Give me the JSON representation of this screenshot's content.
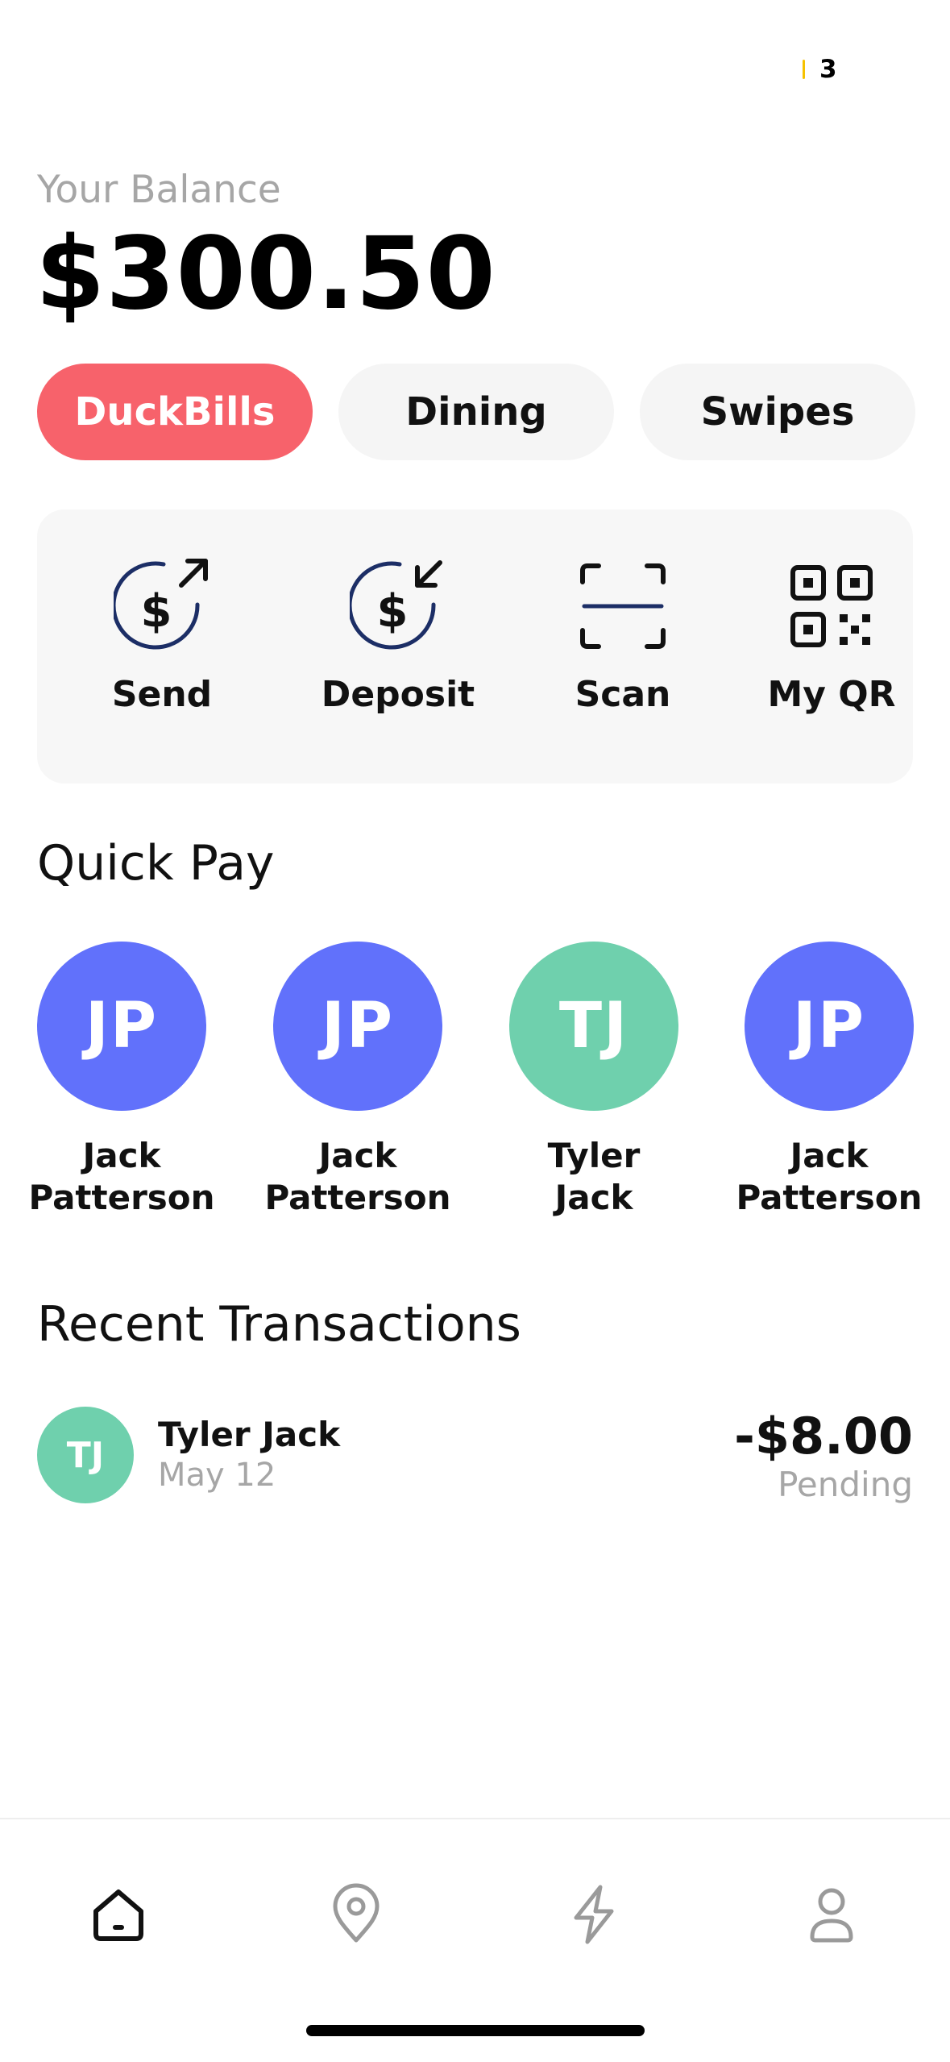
{
  "status": {
    "badge_count": "3"
  },
  "balance": {
    "label": "Your Balance",
    "value": "$300.50"
  },
  "tabs": [
    {
      "label": "DuckBills",
      "active": true
    },
    {
      "label": "Dining",
      "active": false
    },
    {
      "label": "Swipes",
      "active": false
    }
  ],
  "actions": [
    {
      "label": "Send",
      "icon": "dollar-send-icon"
    },
    {
      "label": "Deposit",
      "icon": "dollar-deposit-icon"
    },
    {
      "label": "Scan",
      "icon": "scan-icon"
    },
    {
      "label": "My QR",
      "icon": "qr-code-icon"
    }
  ],
  "quick_pay": {
    "title": "Quick Pay",
    "people": [
      {
        "initials": "JP",
        "first": "Jack",
        "last": "Patterson",
        "color": "#6171fb"
      },
      {
        "initials": "JP",
        "first": "Jack",
        "last": "Patterson",
        "color": "#6171fb"
      },
      {
        "initials": "TJ",
        "first": "Tyler",
        "last": "Jack",
        "color": "#6fd0ad"
      },
      {
        "initials": "JP",
        "first": "Jack",
        "last": "Patterson",
        "color": "#6171fb"
      }
    ]
  },
  "recent": {
    "title": "Recent Transactions",
    "items": [
      {
        "initials": "TJ",
        "name": "Tyler Jack",
        "date": "May 12",
        "amount": "-$8.00",
        "status": "Pending",
        "color": "#6fd0ad"
      }
    ]
  },
  "nav": [
    {
      "icon": "home-icon",
      "active": true
    },
    {
      "icon": "location-pin-icon",
      "active": false
    },
    {
      "icon": "lightning-icon",
      "active": false
    },
    {
      "icon": "profile-icon",
      "active": false
    }
  ],
  "colors": {
    "accent": "#f7626b",
    "purple": "#6171fb",
    "green": "#6fd0ad",
    "navy": "#1c2e66"
  }
}
